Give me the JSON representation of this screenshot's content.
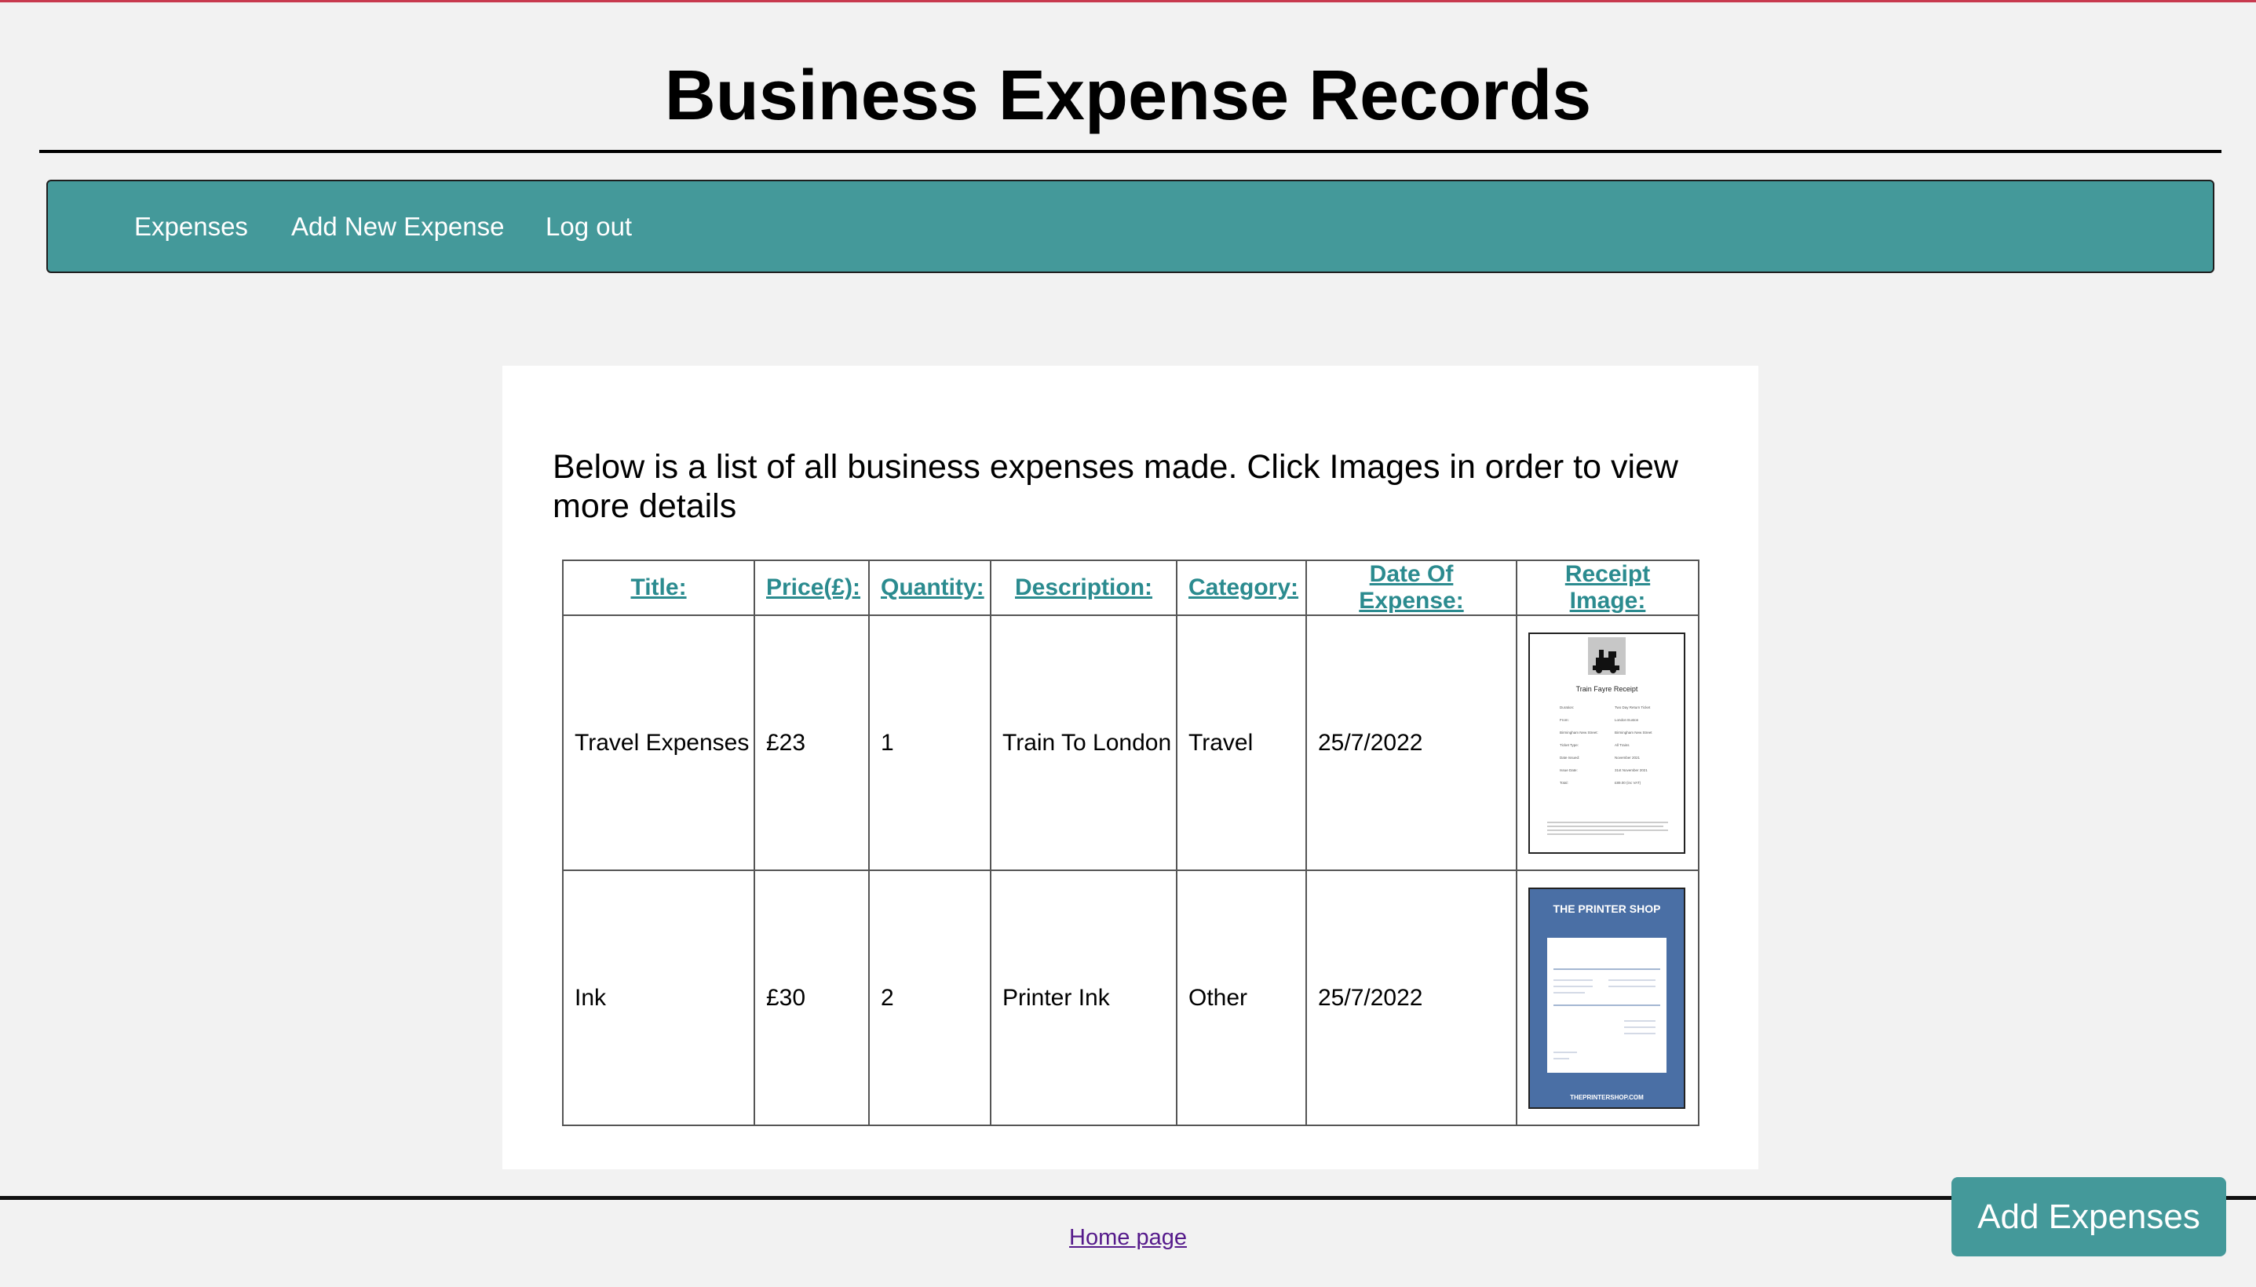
{
  "page": {
    "title": "Business Expense Records"
  },
  "nav": {
    "items": [
      {
        "label": "Expenses"
      },
      {
        "label": "Add New Expense"
      },
      {
        "label": "Log out"
      }
    ]
  },
  "main": {
    "intro": "Below is a list of all business expenses made. Click Images in order to view more details",
    "columns": [
      "Title:",
      "Price(£):",
      "Quantity:",
      "Description:",
      "Category:",
      "Date Of Expense:",
      "Receipt Image:"
    ],
    "rows": [
      {
        "title": "Travel Expenses",
        "price": "£23",
        "quantity": "1",
        "description": "Train To London",
        "category": "Travel",
        "date": "25/7/2022",
        "receipt": "train-receipt-image"
      },
      {
        "title": "Ink",
        "price": "£30",
        "quantity": "2",
        "description": "Printer Ink",
        "category": "Other",
        "date": "25/7/2022",
        "receipt": "printer-shop-receipt-image"
      }
    ]
  },
  "receipts": {
    "train": {
      "heading": "Train Fayre Receipt",
      "lines": [
        {
          "k": "Duration:",
          "v": "Two Day Return Ticket"
        },
        {
          "k": "From:",
          "v": "London Euston"
        },
        {
          "k": "Birmingham New Street:",
          "v": "Birmingham New Street"
        },
        {
          "k": "Ticket Type:",
          "v": "All Trains"
        },
        {
          "k": "Date Issued:",
          "v": "November 2021"
        },
        {
          "k": "Issue Date:",
          "v": "31st November 2021"
        },
        {
          "k": "Total:",
          "v": "£89.00 (inc VAT)"
        }
      ]
    },
    "printer": {
      "header": "THE PRINTER SHOP",
      "footer": "THEPRINTERSHOP.COM"
    }
  },
  "footer": {
    "home_link": "Home page",
    "add_button": "Add Expenses"
  },
  "colors": {
    "accent": "#44999a",
    "top_border": "#c83a4f",
    "link": "#2b8b8f"
  }
}
